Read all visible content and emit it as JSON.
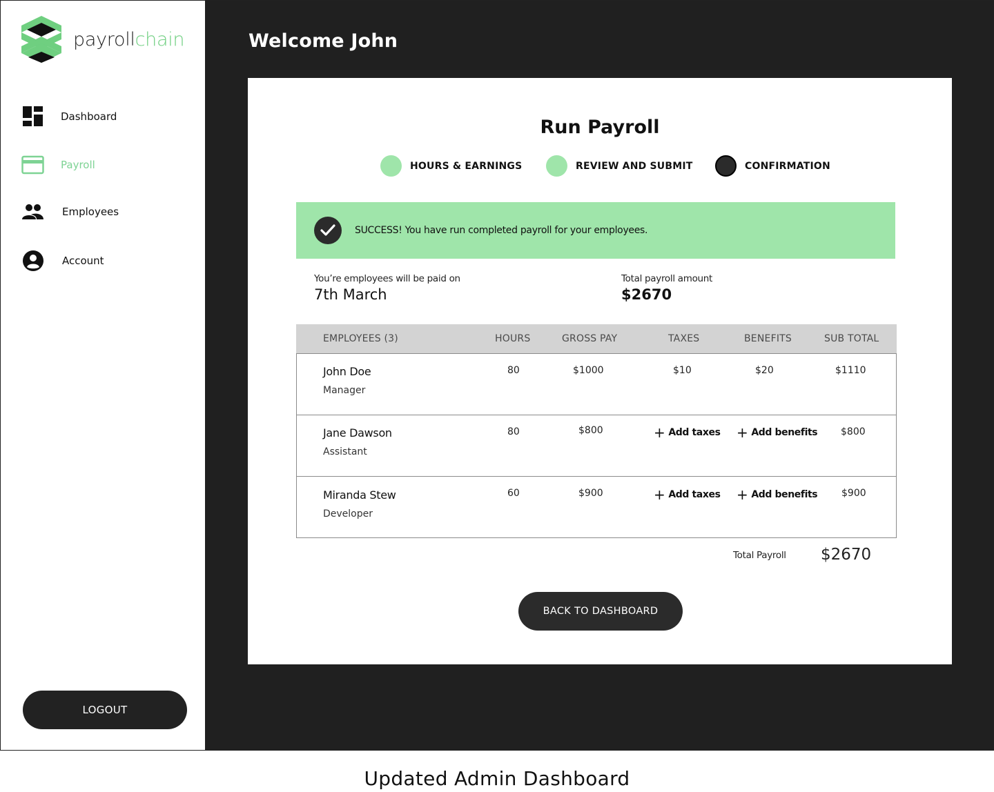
{
  "brand": {
    "name_part1": "payroll",
    "name_part2": "chain",
    "accent_color": "#6fcf80"
  },
  "sidebar": {
    "items": [
      {
        "label": "Dashboard",
        "icon": "dashboard-icon",
        "active": false
      },
      {
        "label": "Payroll",
        "icon": "credit-card-icon",
        "active": true
      },
      {
        "label": "Employees",
        "icon": "people-icon",
        "active": false
      },
      {
        "label": "Account",
        "icon": "account-circle-icon",
        "active": false
      }
    ],
    "logout_label": "LOGOUT"
  },
  "header": {
    "welcome": "Welcome John"
  },
  "payroll": {
    "title": "Run Payroll",
    "steps": [
      {
        "label": "HOURS & EARNINGS",
        "status": "done"
      },
      {
        "label": "REVIEW AND SUBMIT",
        "status": "done"
      },
      {
        "label": "CONFIRMATION",
        "status": "current"
      }
    ],
    "success_message": "SUCCESS! You have run completed payroll for your employees.",
    "pay_date_label": "You’re employees will be paid on",
    "pay_date_value": "7th March",
    "total_amount_label": "Total payroll amount",
    "total_amount_value": "$2670",
    "table": {
      "headers": [
        "EMPLOYEES (3)",
        "HOURS",
        "GROSS PAY",
        "TAXES",
        "BENEFITS",
        "SUB TOTAL"
      ],
      "rows": [
        {
          "name": "John Doe",
          "role": "Manager",
          "hours": "80",
          "gross": "$1000",
          "taxes": "$10",
          "benefits": "$20",
          "subtotal": "$1110"
        },
        {
          "name": "Jane Dawson",
          "role": "Assistant",
          "hours": "80",
          "gross": "$800",
          "taxes": "Add taxes",
          "benefits": "Add benefits",
          "subtotal": "$800"
        },
        {
          "name": "Miranda Stew",
          "role": "Developer",
          "hours": "60",
          "gross": "$900",
          "taxes": "Add taxes",
          "benefits": "Add benefits",
          "subtotal": "$900"
        }
      ]
    },
    "total_payroll_label": "Total Payroll",
    "total_payroll_value": "$2670",
    "back_button_label": "BACK TO DASHBOARD"
  },
  "caption": "Updated Admin Dashboard",
  "colors": {
    "success_bg": "#9fe5aa",
    "dark": "#222222",
    "active_nav": "#7ed394"
  }
}
